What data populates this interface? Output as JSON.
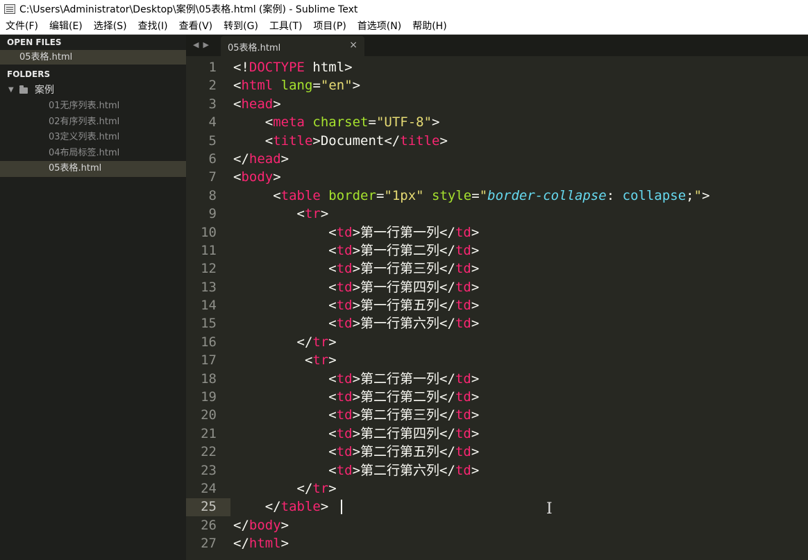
{
  "window": {
    "title": "C:\\Users\\Administrator\\Desktop\\案例\\05表格.html (案例) - Sublime Text"
  },
  "menu": [
    "文件(F)",
    "编辑(E)",
    "选择(S)",
    "查找(I)",
    "查看(V)",
    "转到(G)",
    "工具(T)",
    "项目(P)",
    "首选项(N)",
    "帮助(H)"
  ],
  "sidebar": {
    "open_files_header": "OPEN FILES",
    "open_files": [
      "05表格.html"
    ],
    "folders_header": "FOLDERS",
    "folder": {
      "name": "案例",
      "expanded": true
    },
    "files": [
      {
        "name": "01无序列表.html",
        "active": false
      },
      {
        "name": "02有序列表.html",
        "active": false
      },
      {
        "name": "03定义列表.html",
        "active": false
      },
      {
        "name": "04布局标签.html",
        "active": false
      },
      {
        "name": "05表格.html",
        "active": true
      }
    ]
  },
  "tabs": [
    {
      "label": "05表格.html",
      "close": "×"
    }
  ],
  "editor": {
    "current_line": 25,
    "colors": {
      "background": "#272822",
      "tag": "#f92672",
      "attribute": "#a6e22e",
      "string": "#e6db74",
      "property": "#66d9ef",
      "text": "#f8f8f2"
    },
    "lines": [
      "<!DOCTYPE html>",
      "<html lang=\"en\">",
      "<head>",
      "    <meta charset=\"UTF-8\">",
      "    <title>Document</title>",
      "</head>",
      "<body>",
      "     <table border=\"1px\" style=\"border-collapse: collapse;\">",
      "        <tr>",
      "            <td>第一行第一列</td>",
      "            <td>第一行第二列</td>",
      "            <td>第一行第三列</td>",
      "            <td>第一行第四列</td>",
      "            <td>第一行第五列</td>",
      "            <td>第一行第六列</td>",
      "        </tr>",
      "         <tr>",
      "            <td>第二行第一列</td>",
      "            <td>第二行第二列</td>",
      "            <td>第二行第三列</td>",
      "            <td>第二行第四列</td>",
      "            <td>第二行第五列</td>",
      "            <td>第二行第六列</td>",
      "        </tr>",
      "    </table>",
      "</body>",
      "</html>"
    ]
  }
}
